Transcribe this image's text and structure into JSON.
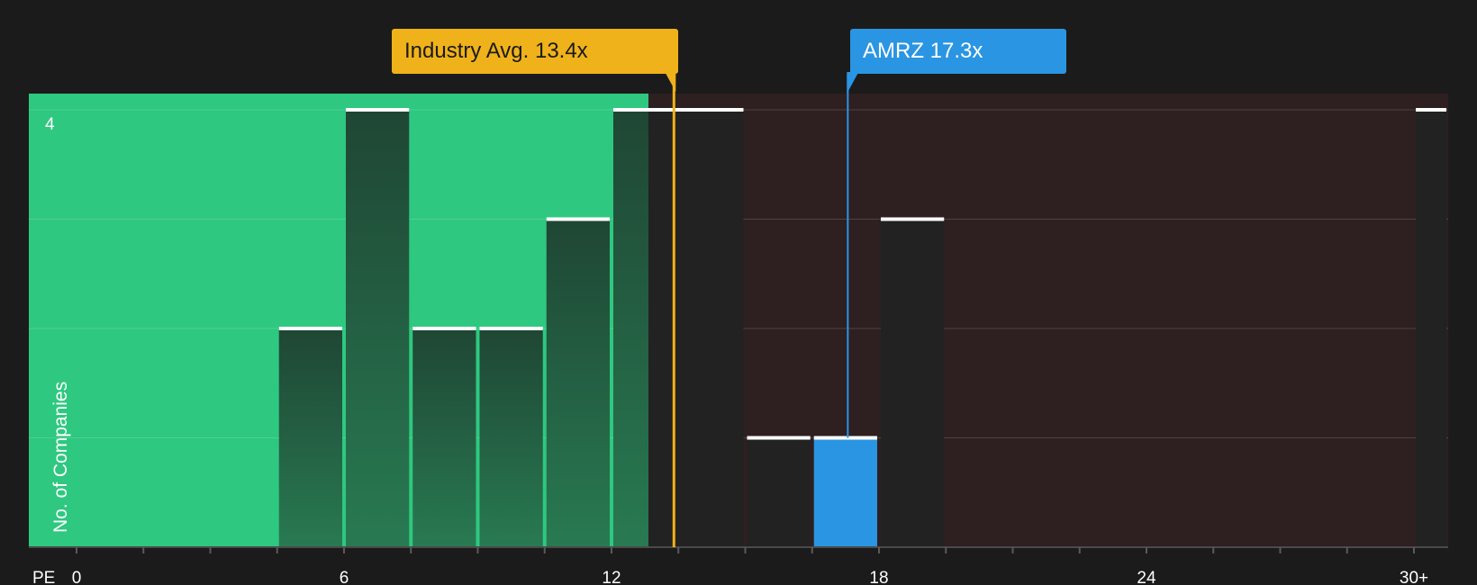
{
  "chart_data": {
    "type": "bar",
    "xlabel": "PE",
    "ylabel": "No. of Companies",
    "xlim": [
      0,
      30
    ],
    "ylim": [
      0,
      4
    ],
    "x_tick_labels": [
      "0",
      "6",
      "12",
      "18",
      "24",
      "30+"
    ],
    "y_tick_labels": [
      "4"
    ],
    "fair_zone_upper": 13.4,
    "bars": [
      {
        "x0": 4.5,
        "x1": 6.0,
        "value": 2
      },
      {
        "x0": 6.0,
        "x1": 7.5,
        "value": 4
      },
      {
        "x0": 7.5,
        "x1": 9.0,
        "value": 2
      },
      {
        "x0": 9.0,
        "x1": 10.5,
        "value": 2
      },
      {
        "x0": 10.5,
        "x1": 12.0,
        "value": 3
      },
      {
        "x0": 12.0,
        "x1": 15.0,
        "value": 4
      },
      {
        "x0": 15.0,
        "x1": 16.5,
        "value": 1
      },
      {
        "x0": 16.5,
        "x1": 18.0,
        "value": 1,
        "highlight": true
      },
      {
        "x0": 18.0,
        "x1": 19.5,
        "value": 3
      },
      {
        "x0": 30.0,
        "x1": 30.8,
        "value": 4
      }
    ],
    "markers": {
      "industry": {
        "label": "Industry Avg. 13.4x",
        "value": 13.4,
        "color": "#f0b21a"
      },
      "company": {
        "label": "AMRZ 17.3x",
        "value": 17.3,
        "color": "#2a95e2"
      }
    },
    "colors": {
      "fair_zone": "#2ec880",
      "expensive_zone": "#2e1f20",
      "bar_in_fair": "#1f4b38",
      "bar_in_expensive": "#222222",
      "highlight": "#2a95e2",
      "background": "#1b1b1b"
    }
  }
}
